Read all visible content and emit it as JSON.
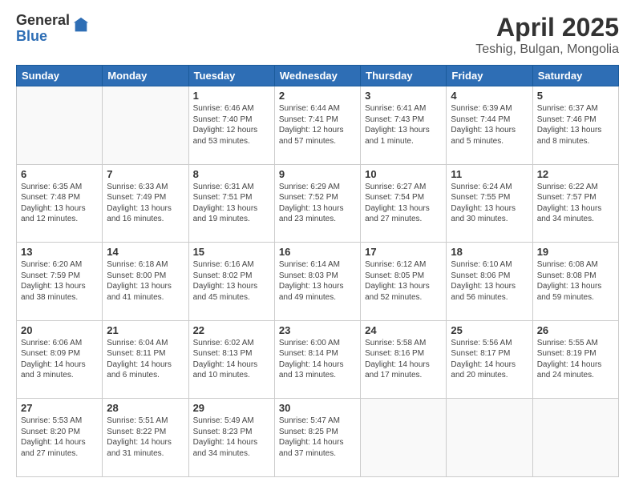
{
  "logo": {
    "general": "General",
    "blue": "Blue"
  },
  "title": "April 2025",
  "location": "Teshig, Bulgan, Mongolia",
  "days": [
    "Sunday",
    "Monday",
    "Tuesday",
    "Wednesday",
    "Thursday",
    "Friday",
    "Saturday"
  ],
  "weeks": [
    [
      {
        "day": "",
        "info": ""
      },
      {
        "day": "",
        "info": ""
      },
      {
        "day": "1",
        "info": "Sunrise: 6:46 AM\nSunset: 7:40 PM\nDaylight: 12 hours\nand 53 minutes."
      },
      {
        "day": "2",
        "info": "Sunrise: 6:44 AM\nSunset: 7:41 PM\nDaylight: 12 hours\nand 57 minutes."
      },
      {
        "day": "3",
        "info": "Sunrise: 6:41 AM\nSunset: 7:43 PM\nDaylight: 13 hours\nand 1 minute."
      },
      {
        "day": "4",
        "info": "Sunrise: 6:39 AM\nSunset: 7:44 PM\nDaylight: 13 hours\nand 5 minutes."
      },
      {
        "day": "5",
        "info": "Sunrise: 6:37 AM\nSunset: 7:46 PM\nDaylight: 13 hours\nand 8 minutes."
      }
    ],
    [
      {
        "day": "6",
        "info": "Sunrise: 6:35 AM\nSunset: 7:48 PM\nDaylight: 13 hours\nand 12 minutes."
      },
      {
        "day": "7",
        "info": "Sunrise: 6:33 AM\nSunset: 7:49 PM\nDaylight: 13 hours\nand 16 minutes."
      },
      {
        "day": "8",
        "info": "Sunrise: 6:31 AM\nSunset: 7:51 PM\nDaylight: 13 hours\nand 19 minutes."
      },
      {
        "day": "9",
        "info": "Sunrise: 6:29 AM\nSunset: 7:52 PM\nDaylight: 13 hours\nand 23 minutes."
      },
      {
        "day": "10",
        "info": "Sunrise: 6:27 AM\nSunset: 7:54 PM\nDaylight: 13 hours\nand 27 minutes."
      },
      {
        "day": "11",
        "info": "Sunrise: 6:24 AM\nSunset: 7:55 PM\nDaylight: 13 hours\nand 30 minutes."
      },
      {
        "day": "12",
        "info": "Sunrise: 6:22 AM\nSunset: 7:57 PM\nDaylight: 13 hours\nand 34 minutes."
      }
    ],
    [
      {
        "day": "13",
        "info": "Sunrise: 6:20 AM\nSunset: 7:59 PM\nDaylight: 13 hours\nand 38 minutes."
      },
      {
        "day": "14",
        "info": "Sunrise: 6:18 AM\nSunset: 8:00 PM\nDaylight: 13 hours\nand 41 minutes."
      },
      {
        "day": "15",
        "info": "Sunrise: 6:16 AM\nSunset: 8:02 PM\nDaylight: 13 hours\nand 45 minutes."
      },
      {
        "day": "16",
        "info": "Sunrise: 6:14 AM\nSunset: 8:03 PM\nDaylight: 13 hours\nand 49 minutes."
      },
      {
        "day": "17",
        "info": "Sunrise: 6:12 AM\nSunset: 8:05 PM\nDaylight: 13 hours\nand 52 minutes."
      },
      {
        "day": "18",
        "info": "Sunrise: 6:10 AM\nSunset: 8:06 PM\nDaylight: 13 hours\nand 56 minutes."
      },
      {
        "day": "19",
        "info": "Sunrise: 6:08 AM\nSunset: 8:08 PM\nDaylight: 13 hours\nand 59 minutes."
      }
    ],
    [
      {
        "day": "20",
        "info": "Sunrise: 6:06 AM\nSunset: 8:09 PM\nDaylight: 14 hours\nand 3 minutes."
      },
      {
        "day": "21",
        "info": "Sunrise: 6:04 AM\nSunset: 8:11 PM\nDaylight: 14 hours\nand 6 minutes."
      },
      {
        "day": "22",
        "info": "Sunrise: 6:02 AM\nSunset: 8:13 PM\nDaylight: 14 hours\nand 10 minutes."
      },
      {
        "day": "23",
        "info": "Sunrise: 6:00 AM\nSunset: 8:14 PM\nDaylight: 14 hours\nand 13 minutes."
      },
      {
        "day": "24",
        "info": "Sunrise: 5:58 AM\nSunset: 8:16 PM\nDaylight: 14 hours\nand 17 minutes."
      },
      {
        "day": "25",
        "info": "Sunrise: 5:56 AM\nSunset: 8:17 PM\nDaylight: 14 hours\nand 20 minutes."
      },
      {
        "day": "26",
        "info": "Sunrise: 5:55 AM\nSunset: 8:19 PM\nDaylight: 14 hours\nand 24 minutes."
      }
    ],
    [
      {
        "day": "27",
        "info": "Sunrise: 5:53 AM\nSunset: 8:20 PM\nDaylight: 14 hours\nand 27 minutes."
      },
      {
        "day": "28",
        "info": "Sunrise: 5:51 AM\nSunset: 8:22 PM\nDaylight: 14 hours\nand 31 minutes."
      },
      {
        "day": "29",
        "info": "Sunrise: 5:49 AM\nSunset: 8:23 PM\nDaylight: 14 hours\nand 34 minutes."
      },
      {
        "day": "30",
        "info": "Sunrise: 5:47 AM\nSunset: 8:25 PM\nDaylight: 14 hours\nand 37 minutes."
      },
      {
        "day": "",
        "info": ""
      },
      {
        "day": "",
        "info": ""
      },
      {
        "day": "",
        "info": ""
      }
    ]
  ]
}
